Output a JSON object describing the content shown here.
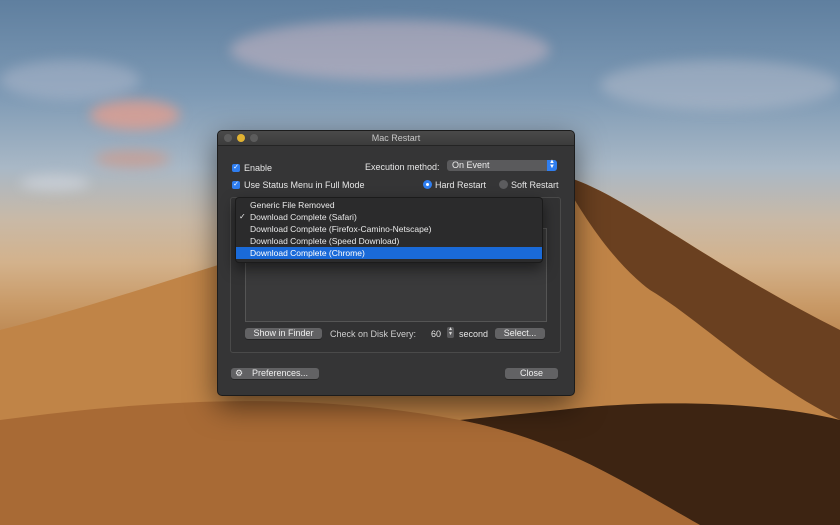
{
  "window": {
    "title": "Mac Restart"
  },
  "options": {
    "enable_label": "Enable",
    "status_menu_label": "Use Status Menu in Full Mode",
    "execution_method_label": "Execution method:",
    "execution_method_value": "On Event",
    "hard_restart_label": "Hard Restart",
    "soft_restart_label": "Soft Restart"
  },
  "event_menu": {
    "items": [
      {
        "label": "Generic File Removed",
        "checked": false,
        "selected": false
      },
      {
        "label": "Download Complete (Safari)",
        "checked": true,
        "selected": false
      },
      {
        "label": "Download Complete (Firefox-Camino-Netscape)",
        "checked": false,
        "selected": false
      },
      {
        "label": "Download Complete (Speed Download)",
        "checked": false,
        "selected": false
      },
      {
        "label": "Download Complete (Chrome)",
        "checked": false,
        "selected": true
      }
    ]
  },
  "panel": {
    "show_in_finder": "Show in Finder",
    "check_label": "Check on Disk Every:",
    "interval_value": "60",
    "interval_unit": "second",
    "select_button": "Select..."
  },
  "footer": {
    "preferences_button": "Preferences...",
    "close_button": "Close"
  },
  "icons": {
    "checkmark": "✓",
    "gear": "⚙"
  },
  "colors": {
    "accent": "#2f7ef0",
    "selection": "#1a6ad8"
  }
}
